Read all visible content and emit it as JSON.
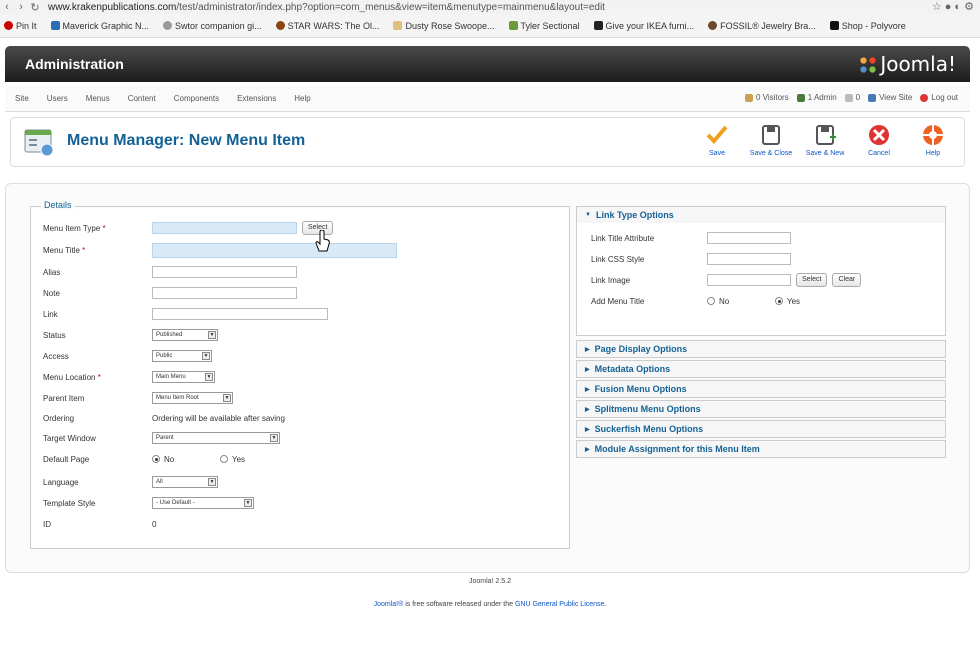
{
  "browser": {
    "url_prefix": "www.krakenpublications.com",
    "url_rest": "/test/administrator/index.php?option=com_menus&view=item&menutype=mainmenu&layout=edit",
    "bookmarks": [
      "Pin It",
      "Maverick Graphic N...",
      "Swtor companion gi...",
      "STAR WARS: The Ol...",
      "Dusty Rose Swoope...",
      "Tyler Sectional",
      "Give your IKEA furni...",
      "FOSSIL® Jewelry Bra...",
      "Shop - Polyvore"
    ]
  },
  "header": {
    "title": "Administration",
    "logo": "Joomla!"
  },
  "menubar": {
    "items": [
      "Site",
      "Users",
      "Menus",
      "Content",
      "Components",
      "Extensions",
      "Help"
    ],
    "visitors": "0 Visitors",
    "admins": "1 Admin",
    "messages": "0",
    "view_site": "View Site",
    "logout": "Log out"
  },
  "toolbar": {
    "title": "Menu Manager: New Menu Item",
    "save": "Save",
    "save_close": "Save & Close",
    "save_new": "Save & New",
    "cancel": "Cancel",
    "help": "Help"
  },
  "details": {
    "legend": "Details",
    "menu_item_type": "Menu Item Type",
    "select": "Select",
    "menu_title": "Menu Title",
    "alias": "Alias",
    "note": "Note",
    "link": "Link",
    "status": "Status",
    "status_value": "Published",
    "access": "Access",
    "access_value": "Public",
    "menu_location": "Menu Location",
    "menu_location_value": "Main Menu",
    "parent_item": "Parent Item",
    "parent_item_value": "Menu Item Root",
    "ordering": "Ordering",
    "ordering_value": "Ordering will be available after saving",
    "target_window": "Target Window",
    "target_window_value": "Parent",
    "default_page": "Default Page",
    "no": "No",
    "yes": "Yes",
    "language": "Language",
    "language_value": "All",
    "template_style": "Template Style",
    "template_style_value": "- Use Default -",
    "id": "ID",
    "id_value": "0"
  },
  "link_type": {
    "heading": "Link Type Options",
    "title_attr": "Link Title Attribute",
    "css_style": "Link CSS Style",
    "image": "Link Image",
    "select": "Select",
    "clear": "Clear",
    "add_menu_title": "Add Menu Title",
    "no": "No",
    "yes": "Yes"
  },
  "panels": [
    "Page Display Options",
    "Metadata Options",
    "Fusion Menu Options",
    "Splitmenu Menu Options",
    "Suckerfish Menu Options",
    "Module Assignment for this Menu Item"
  ],
  "footer": {
    "version": "Joomla! 2.5.2",
    "link": "Joomla!®",
    "text": " is free software released under the ",
    "license": "GNU General Public License",
    "end": "."
  }
}
